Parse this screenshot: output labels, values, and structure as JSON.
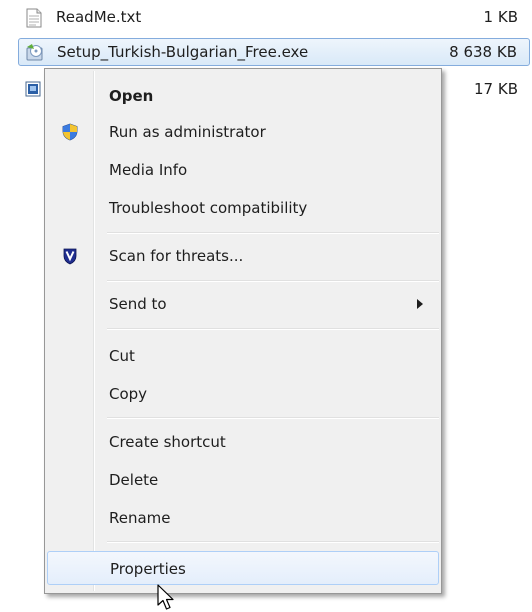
{
  "files": [
    {
      "name": "ReadMe.txt",
      "size": "1 KB",
      "icon": "text-file-icon",
      "selected": false
    },
    {
      "name": "Setup_Turkish-Bulgarian_Free.exe",
      "size": "8 638 KB",
      "icon": "setup-exe-icon",
      "selected": true
    },
    {
      "name": "",
      "size": "17 KB",
      "icon": "application-file-icon",
      "selected": false
    }
  ],
  "context_menu": {
    "items": [
      {
        "label": "Open",
        "bold": true
      },
      {
        "label": "Run as administrator",
        "icon": "uac-shield-icon"
      },
      {
        "label": "Media Info"
      },
      {
        "label": "Troubleshoot compatibility"
      },
      {
        "label": "Scan for threats...",
        "icon": "antivirus-shield-icon"
      },
      {
        "label": "Send to",
        "submenu": true
      },
      {
        "label": "Cut"
      },
      {
        "label": "Copy"
      },
      {
        "label": "Create shortcut"
      },
      {
        "label": "Delete"
      },
      {
        "label": "Rename"
      },
      {
        "label": "Properties",
        "highlighted": true
      }
    ]
  },
  "colors": {
    "selection_border": "#84acdd",
    "menu_background": "#f0f0f0",
    "highlight_border": "#aecff7"
  }
}
